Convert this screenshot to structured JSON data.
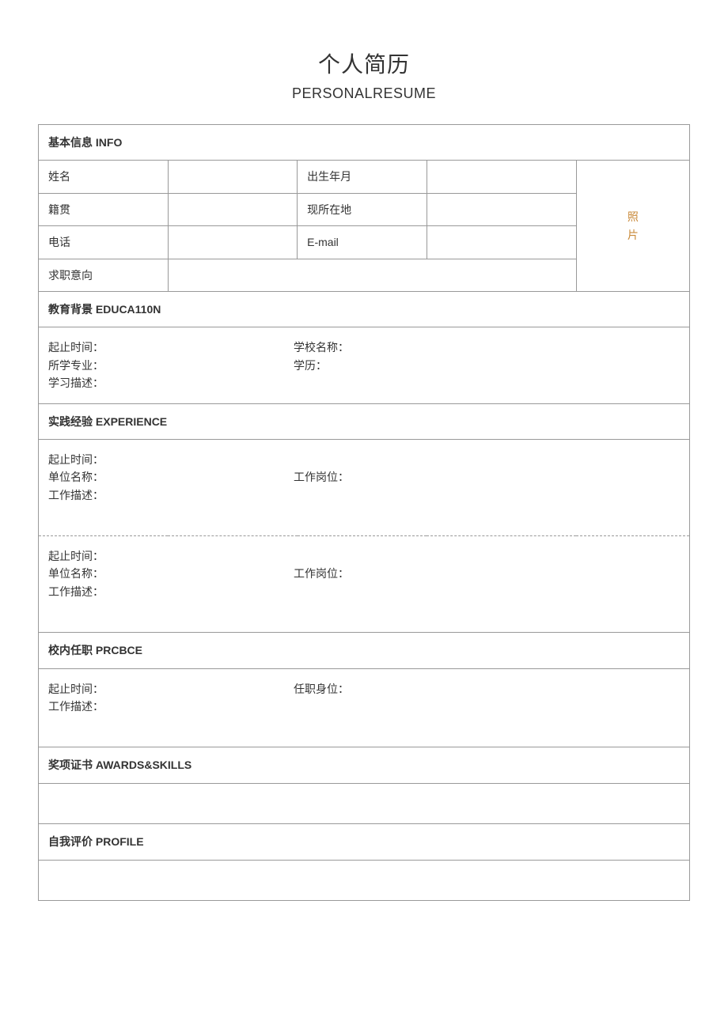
{
  "header": {
    "title": "个人简历",
    "subtitle": "PERSONALRESUME"
  },
  "sections": {
    "info": {
      "heading": "基本信息 INFO",
      "name_label": "姓名",
      "birth_label": "出生年月",
      "origin_label": "籍贯",
      "location_label": "现所在地",
      "phone_label": "电话",
      "email_label": "E-mail",
      "intent_label": "求职意向",
      "photo_line1": "照",
      "photo_line2": "片"
    },
    "education": {
      "heading": "教育背景 EDUCA110N",
      "period_label": "起止时间：",
      "school_label": "学校名称：",
      "major_label": "所学专业：",
      "degree_label": "学历：",
      "desc_label": "学习描述："
    },
    "experience": {
      "heading": "实践经验 EXPERIENCE",
      "block1": {
        "period_label": "起止时间：",
        "company_label": "单位名称：",
        "position_label": "工作岗位：",
        "desc_label": "工作描述："
      },
      "block2": {
        "period_label": "起止时间：",
        "company_label": "单位名称：",
        "position_label": "工作岗位：",
        "desc_label": "工作描述："
      }
    },
    "campus": {
      "heading": "校内任职 PRCBCE",
      "period_label": "起止时间：",
      "role_label": "任职身位：",
      "desc_label": "工作描述："
    },
    "awards": {
      "heading": "奖项证书 AWARDS&SKILLS"
    },
    "profile": {
      "heading": "自我评价 PROFILE"
    }
  }
}
